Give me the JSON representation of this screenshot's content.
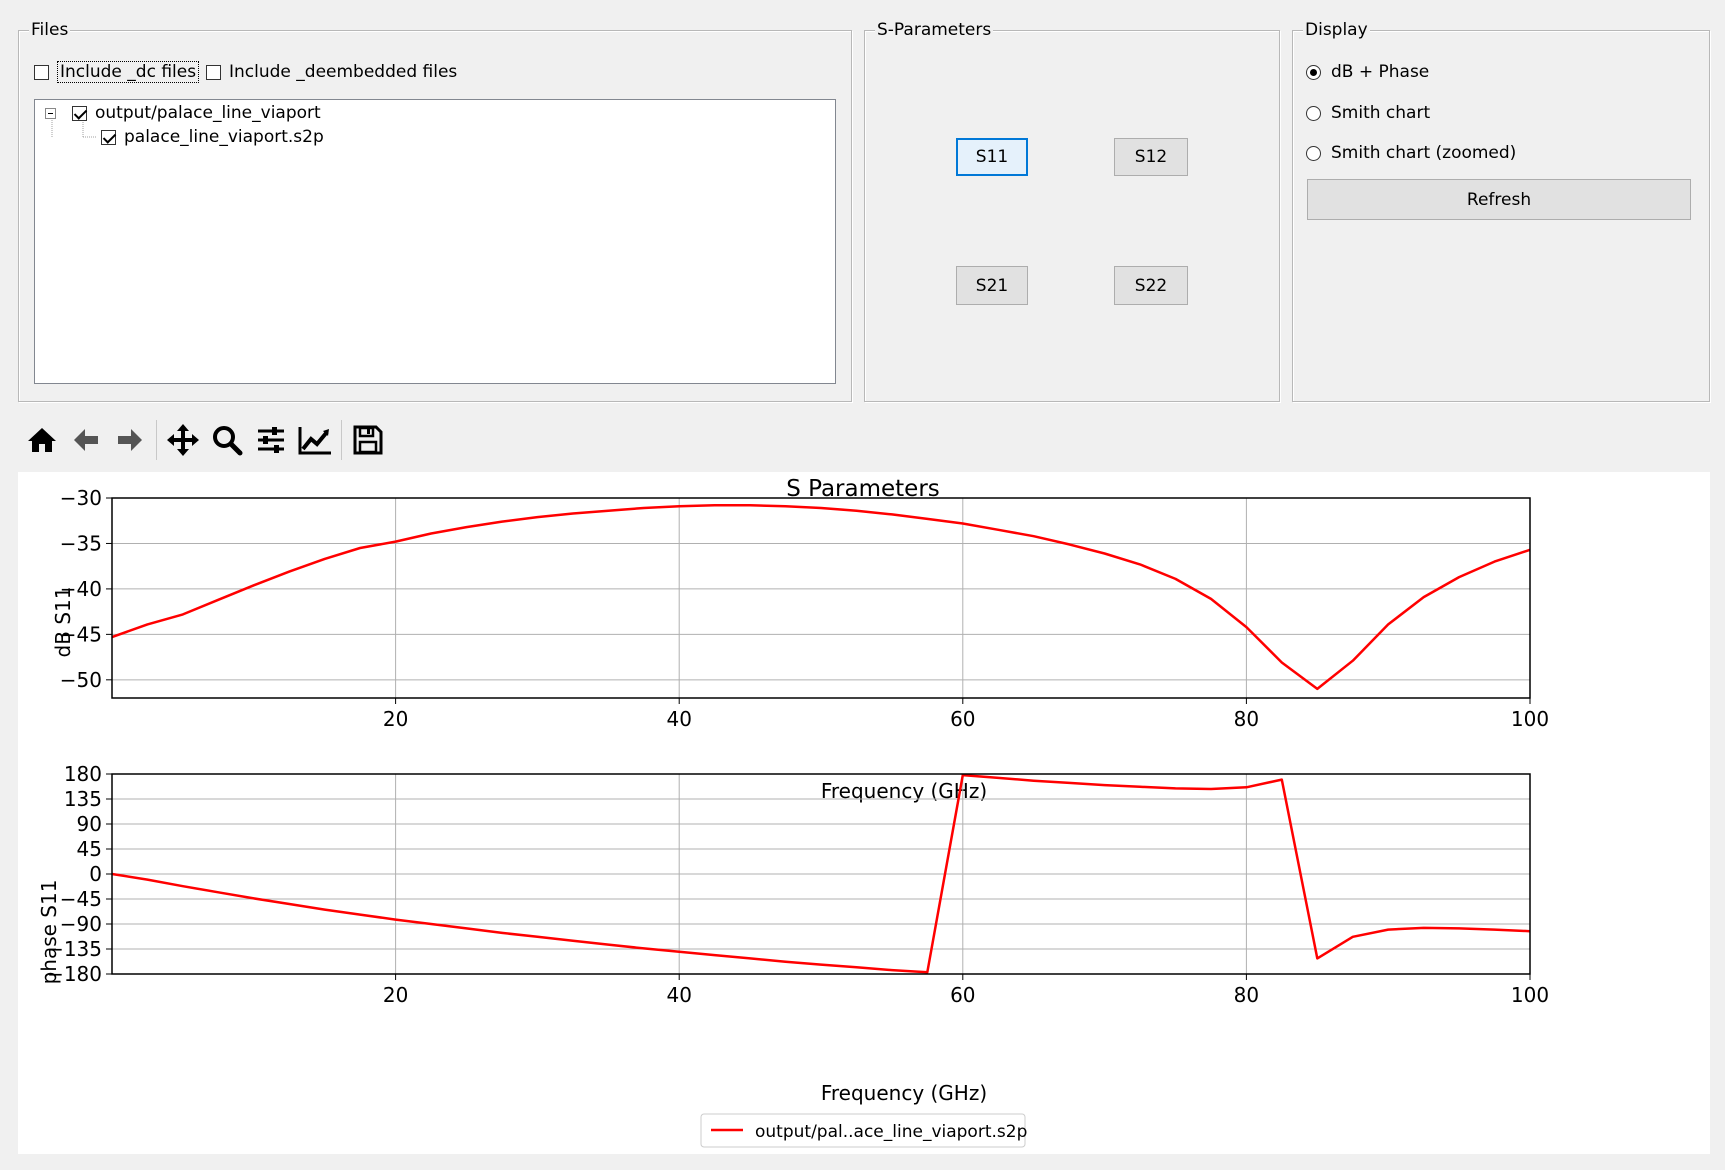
{
  "files_group": {
    "title": "Files",
    "include_dc_label": "Include _dc files",
    "include_dc_checked": false,
    "include_deembedded_label": "Include _deembedded files",
    "include_deembedded_checked": false,
    "tree": {
      "folder_label": "output/palace_line_viaport",
      "folder_checked": true,
      "file_label": "palace_line_viaport.s2p",
      "file_checked": true
    }
  },
  "sparams_group": {
    "title": "S-Parameters",
    "s11": "S11",
    "s12": "S12",
    "s21": "S21",
    "s22": "S22"
  },
  "display_group": {
    "title": "Display",
    "options": [
      "dB + Phase",
      "Smith chart",
      "Smith chart (zoomed)"
    ],
    "selected": "dB + Phase",
    "refresh_label": "Refresh"
  },
  "toolbar": {
    "icons": [
      "home-icon",
      "back-arrow-icon",
      "forward-arrow-icon",
      "pan-icon",
      "zoom-icon",
      "configure-subplots-icon",
      "edit-axis-icon",
      "save-icon"
    ]
  },
  "chart_data": [
    {
      "type": "line",
      "title": "S Parameters",
      "xlabel": "Frequency (GHz)",
      "ylabel": "dB S11",
      "xlim": [
        0,
        100
      ],
      "ylim": [
        -52,
        -30
      ],
      "xticks": [
        "20",
        "40",
        "60",
        "80",
        "100"
      ],
      "yticks": [
        "−30",
        "−35",
        "−40",
        "−45",
        "−50"
      ],
      "grid": true,
      "color": "#ff0000",
      "series": [
        {
          "name": "output/pal..ace_line_viaport.s2p",
          "x": [
            0,
            2.5,
            5,
            7.5,
            10,
            12.5,
            15,
            17.5,
            20,
            22.5,
            25,
            27.5,
            30,
            32.5,
            35,
            37.5,
            40,
            42.5,
            45,
            47.5,
            50,
            52.5,
            55,
            57.5,
            60,
            62.5,
            65,
            67.5,
            70,
            72.5,
            75,
            77.5,
            80,
            82.5,
            85,
            87.5,
            90,
            92.5,
            95,
            97.5,
            100
          ],
          "y": [
            -45.3,
            -43.9,
            -42.8,
            -41.2,
            -39.6,
            -38.1,
            -36.7,
            -35.5,
            -34.8,
            -33.9,
            -33.2,
            -32.6,
            -32.1,
            -31.7,
            -31.4,
            -31.1,
            -30.9,
            -30.8,
            -30.8,
            -30.9,
            -31.1,
            -31.4,
            -31.8,
            -32.3,
            -32.8,
            -33.5,
            -34.2,
            -35.1,
            -36.1,
            -37.3,
            -38.9,
            -41.1,
            -44.2,
            -48.1,
            -51.0,
            -47.9,
            -43.9,
            -40.9,
            -38.7,
            -37.0,
            -35.7
          ]
        }
      ]
    },
    {
      "type": "line",
      "xlabel": "Frequency (GHz)",
      "ylabel": "phase S11",
      "xlim": [
        0,
        100
      ],
      "ylim": [
        -180,
        180
      ],
      "xticks": [
        "20",
        "40",
        "60",
        "80",
        "100"
      ],
      "yticks": [
        "180",
        "135",
        "90",
        "45",
        "0",
        "−45",
        "−90",
        "−135",
        "−180"
      ],
      "grid": true,
      "legend_position": "bottom-center",
      "color": "#ff0000",
      "series": [
        {
          "name": "output/pal..ace_line_viaport.s2p",
          "x": [
            0,
            2.5,
            5,
            7.5,
            10,
            12.5,
            15,
            17.5,
            20,
            22.5,
            25,
            27.5,
            30,
            32.5,
            35,
            37.5,
            40,
            42.5,
            45,
            47.5,
            50,
            52.5,
            55,
            57.5,
            60,
            62.5,
            65,
            67.5,
            70,
            72.5,
            75,
            77.5,
            80,
            82.5,
            85,
            87.5,
            90,
            92.5,
            95,
            97.5,
            100
          ],
          "y": [
            0,
            -10,
            -22,
            -33,
            -44,
            -54,
            -64,
            -73,
            -82,
            -90,
            -98,
            -106,
            -113,
            -120,
            -127,
            -134,
            -140,
            -146,
            -152,
            -158,
            -163,
            -168,
            -173,
            -177,
            178,
            173,
            168,
            164,
            160,
            157,
            154,
            153,
            156,
            170,
            -152,
            -113,
            -100,
            -97,
            -98,
            -100,
            -103
          ]
        }
      ]
    }
  ]
}
